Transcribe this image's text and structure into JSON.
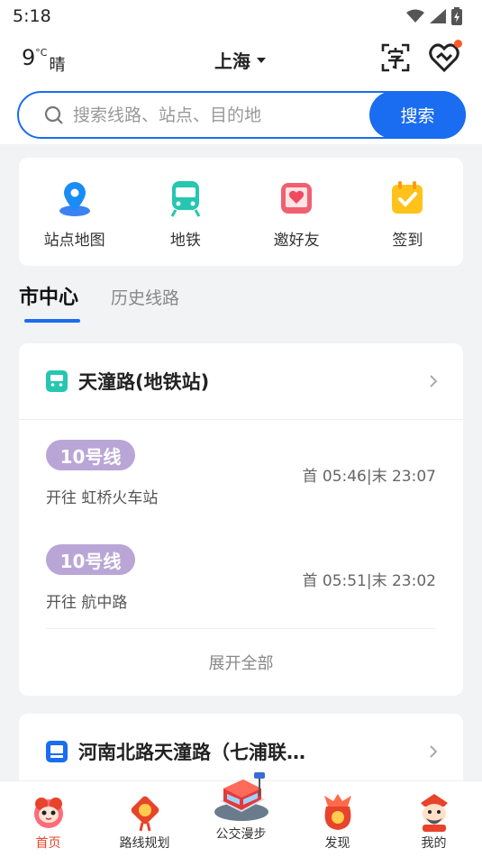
{
  "status": {
    "time": "5:18"
  },
  "header": {
    "temperature": "9",
    "temp_unit": "°C",
    "condition": "晴",
    "city": "上海"
  },
  "search": {
    "placeholder": "搜索线路、站点、目的地",
    "button": "搜索"
  },
  "quick": [
    {
      "label": "站点地图",
      "icon": "map-pin-icon"
    },
    {
      "label": "地铁",
      "icon": "metro-icon"
    },
    {
      "label": "邀好友",
      "icon": "invite-heart-icon"
    },
    {
      "label": "签到",
      "icon": "calendar-check-icon"
    }
  ],
  "tabs": [
    {
      "label": "市中心",
      "active": true
    },
    {
      "label": "历史线路",
      "active": false
    }
  ],
  "station1": {
    "name": "天潼路(地铁站)",
    "lines": [
      {
        "line": "10号线",
        "dest": "开往 虹桥火车站",
        "times": "首 05:46|末 23:07"
      },
      {
        "line": "10号线",
        "dest": "开往 航中路",
        "times": "首 05:51|末 23:02"
      }
    ],
    "expand": "展开全部"
  },
  "station2": {
    "name": "河南北路天潼路（七浦联…"
  },
  "nav": [
    {
      "label": "首页",
      "active": true
    },
    {
      "label": "路线规划",
      "active": false
    },
    {
      "label": "公交漫步",
      "active": false
    },
    {
      "label": "发现",
      "active": false
    },
    {
      "label": "我的",
      "active": false
    }
  ],
  "colors": {
    "accent": "#1a6cf0",
    "badge": "#b9a6d6",
    "nav_active": "#e8432b"
  }
}
